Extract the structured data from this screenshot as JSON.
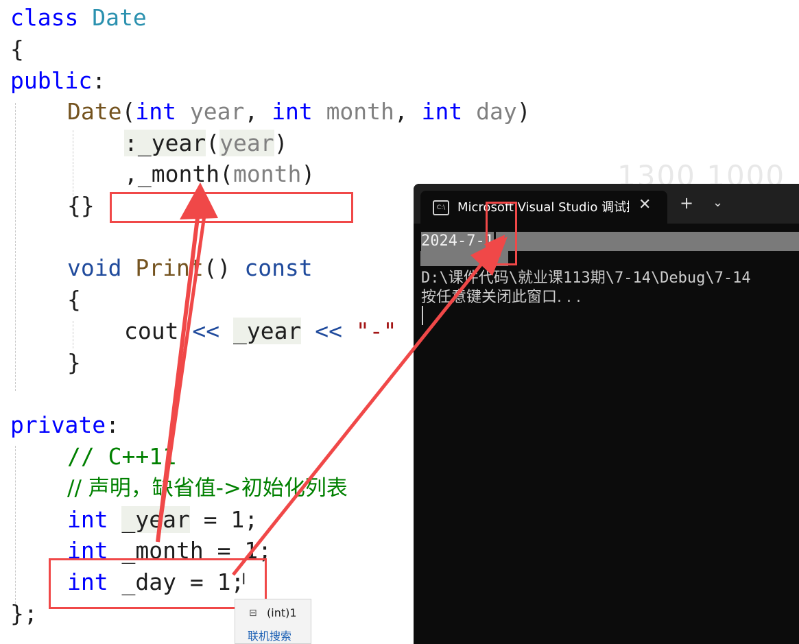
{
  "code": {
    "line1": {
      "kw": "class",
      "name": "Date"
    },
    "line2": "{",
    "line3": {
      "kw": "public",
      "punct": ":"
    },
    "line4": {
      "fn": "Date",
      "p1": "(",
      "t1": "int",
      "a1": "year",
      "c1": ", ",
      "t2": "int",
      "a2": "month",
      "c2": ", ",
      "t3": "int",
      "a3": "day",
      "p2": ")"
    },
    "line5": {
      "colon": ":",
      "member": "_year",
      "open": "(",
      "arg": "year",
      "close": ")"
    },
    "line6": {
      "comma": ",",
      "member": "_month",
      "open": "(",
      "arg": "month",
      "close": ")"
    },
    "line7": "{}",
    "line8": {
      "kw": "void",
      "fn": "Print",
      "parens": "()",
      "kw2": "const"
    },
    "line9": "{",
    "line10": {
      "cout": "cout",
      "op1": "<<",
      "member": "_year",
      "op2": "<<",
      "str": "\"-\""
    },
    "line11": "}",
    "line12": {
      "kw": "private",
      "punct": ":"
    },
    "line13": "// C++11",
    "line14": "// 声明，缺省值->初始化列表",
    "line15": {
      "kw": "int",
      "member": "_year",
      "rest": " = 1;"
    },
    "line16": {
      "kw": "int",
      "member": "_month",
      "rest": " = 1;"
    },
    "line17": {
      "kw": "int",
      "member": "_day",
      "rest": " = 1;"
    },
    "line18": "};"
  },
  "terminal": {
    "tab_title": "Microsoft Visual Studio 调试控",
    "tab_close": "✕",
    "new_tab": "+",
    "dropdown": "⌄",
    "output_line1": "2024-7-1",
    "output_line3": "D:\\课件代码\\就业课113期\\7-14\\Debug\\7-14",
    "output_line4": "按任意键关闭此窗口. . ."
  },
  "tooltip": {
    "icon": "⊟",
    "value": "(int)1",
    "link": "联机搜索"
  },
  "watermark": "1300 1000",
  "colors": {
    "annotation_red": "#f04848",
    "keyword": "#0000ff",
    "type_name": "#2b91af",
    "comment": "#008000",
    "terminal_bg": "#0c0c0c"
  }
}
